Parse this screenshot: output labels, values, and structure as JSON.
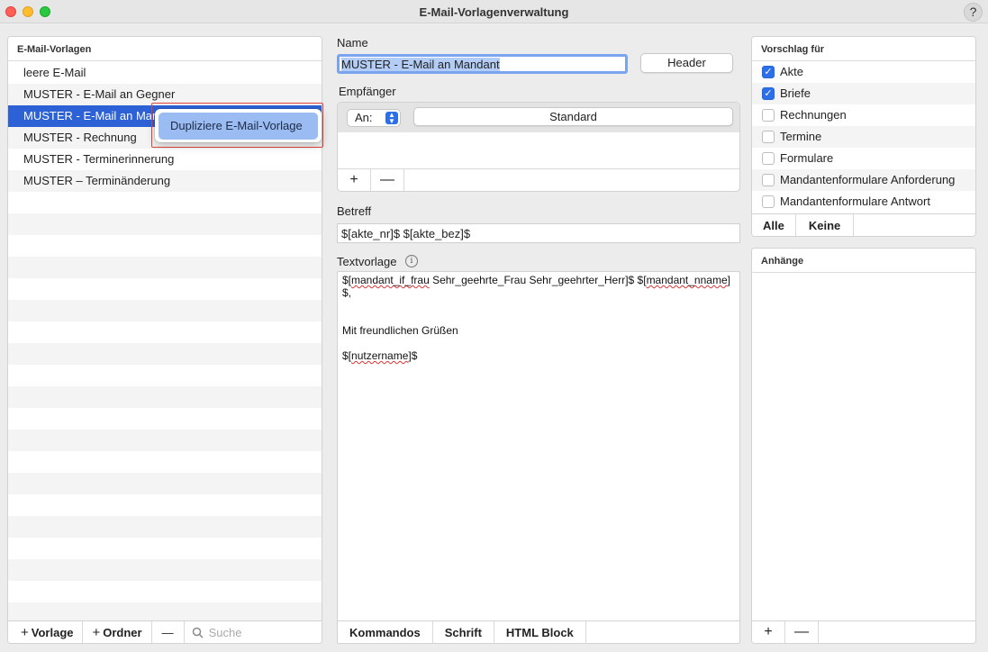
{
  "window": {
    "title": "E-Mail-Vorlagenverwaltung",
    "help": "?"
  },
  "templates_panel": {
    "header": "E-Mail-Vorlagen",
    "items": [
      "leere E-Mail",
      "MUSTER - E-Mail an Gegner",
      "MUSTER - E-Mail an Mandant",
      "MUSTER - Rechnung",
      "MUSTER - Terminerinnerung",
      "MUSTER – Terminänderung"
    ],
    "selected_index": 2,
    "footer": {
      "add_template": "Vorlage",
      "add_folder": "Ordner",
      "remove": "—",
      "search_placeholder": "Suche"
    }
  },
  "context_menu": {
    "item": "Dupliziere E-Mail-Vorlage"
  },
  "editor": {
    "name_label": "Name",
    "name_value": "MUSTER - E-Mail an Mandant",
    "header_button": "Header",
    "recipients_label": "Empfänger",
    "recipient_type": "An:",
    "recipient_value": "Standard",
    "subject_label": "Betreff",
    "subject_value": "$[akte_nr]$ $[akte_bez]$",
    "body_label": "Textvorlage",
    "body_lines": [
      "$[mandant_if_frau Sehr_geehrte_Frau Sehr_geehrter_Herr]$ $[mandant_nname]",
      "$,",
      "",
      "",
      "Mit freundlichen Grüßen",
      "",
      "$[nutzername]$"
    ],
    "body_tabs": [
      "Kommandos",
      "Schrift",
      "HTML Block"
    ]
  },
  "suggest_panel": {
    "header": "Vorschlag für",
    "options": [
      {
        "label": "Akte",
        "checked": true
      },
      {
        "label": "Briefe",
        "checked": true
      },
      {
        "label": "Rechnungen",
        "checked": false
      },
      {
        "label": "Termine",
        "checked": false
      },
      {
        "label": "Formulare",
        "checked": false
      },
      {
        "label": "Mandantenformulare Anforderung",
        "checked": false
      },
      {
        "label": "Mandantenformulare Antwort",
        "checked": false
      }
    ],
    "all_button": "Alle",
    "none_button": "Keine"
  },
  "attachments_panel": {
    "header": "Anhänge"
  },
  "colors": {
    "selection": "#2d62d7",
    "accent": "#2d6fe6",
    "highlight_border": "#e0453a"
  }
}
